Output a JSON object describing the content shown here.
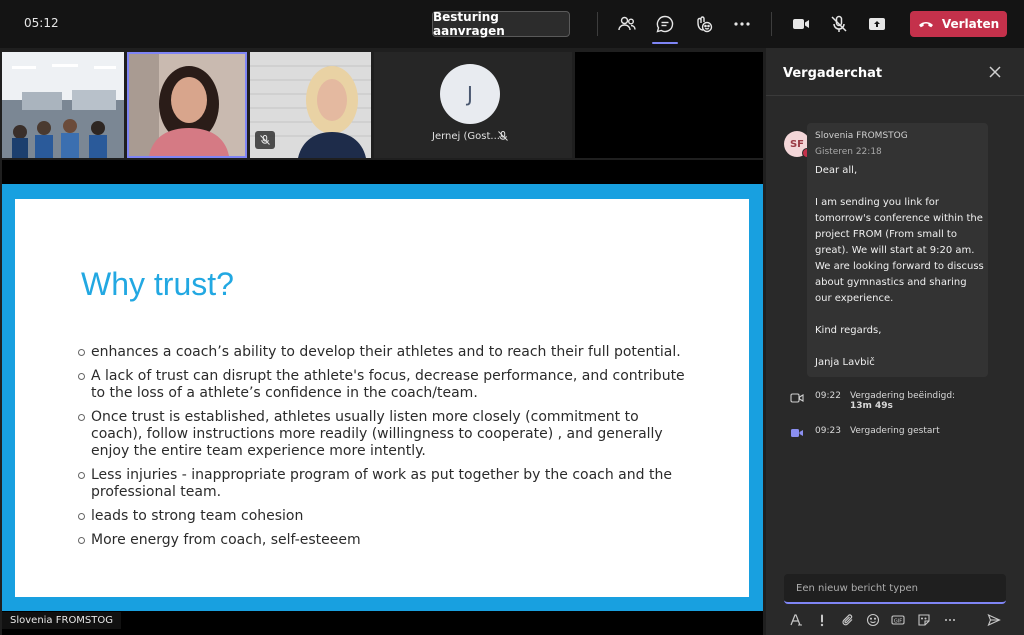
{
  "topbar": {
    "timer": "05:12",
    "request_control_label": "Besturing aanvragen",
    "leave_label": "Verlaten",
    "icons": [
      "people-icon",
      "chat-icon",
      "reactions-icon",
      "more-options-icon",
      "camera-icon",
      "mic-off-icon",
      "share-screen-icon",
      "phone-hangup-icon"
    ],
    "accent_color": "#7f85f5",
    "leave_color": "#c4314b"
  },
  "video_strip": {
    "participant_initial": "J",
    "participant_name": "Jernej (Gost...",
    "participant_avatar_color": "#e8ebf0"
  },
  "slide": {
    "title": "Why trust?",
    "title_color": "#22a8e2",
    "frame_color": "#18a0e0",
    "bullets": [
      "enhances a coach’s ability to develop their athletes and to reach their full potential.",
      "A lack of trust can disrupt the athlete's focus, decrease performance, and contribute to the loss of a athlete’s confidence in the coach/team.",
      "Once trust is established, athletes usually listen more closely (commitment to coach), follow instructions more readily (willingness to cooperate) , and generally enjoy the entire team experience more intently.",
      "Less injuries - inappropriate program of work as put together by the coach and the professional team.",
      "leads to strong team cohesion",
      "More energy from coach, self-esteeem"
    ]
  },
  "presenter_label": "Slovenia FROMSTOG",
  "chat": {
    "title": "Vergaderchat",
    "message": {
      "avatar_initials": "SF",
      "author": "Slovenia FROMSTOG",
      "time": "Gisteren 22:18",
      "paragraphs": [
        "Dear all,",
        "I am sending you link for tomorrow's conference within the project FROM (From small to great). We will start at 9:20 am. We are looking forward to discuss about gymnastics and sharing our experience.",
        "Kind regards,",
        "Janja Lavbič"
      ]
    },
    "events": [
      {
        "time": "09:22",
        "text": "Vergadering beëindigd:",
        "duration": "13m 49s",
        "icon": "camera-outline-icon"
      },
      {
        "time": "09:23",
        "text": "Vergadering gestart",
        "icon": "camera-filled-icon"
      }
    ],
    "compose_placeholder": "Een nieuw bericht typen",
    "compose_icons": [
      "format-icon",
      "important-icon",
      "attach-icon",
      "emoji-icon",
      "gif-icon",
      "sticker-icon",
      "more-options-icon",
      "send-icon"
    ]
  }
}
